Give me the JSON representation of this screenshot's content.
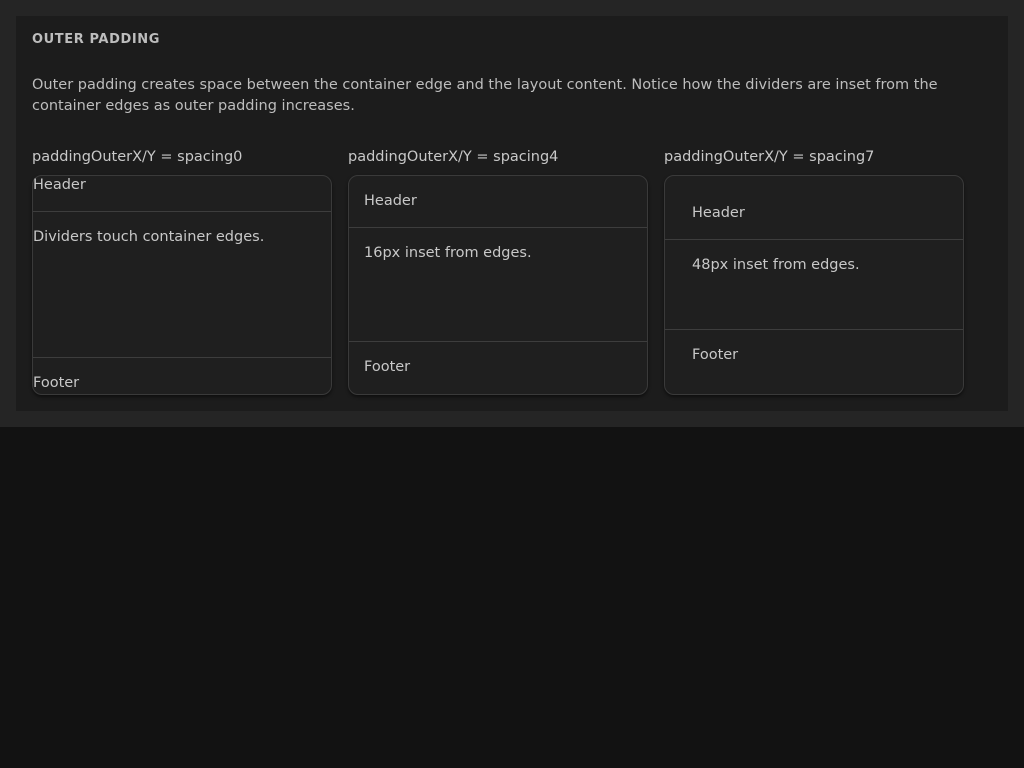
{
  "section": {
    "title": "OUTER PADDING",
    "description": "Outer padding creates space between the container edge and the layout content. Notice how the dividers are inset from the container edges as outer padding increases."
  },
  "examples": [
    {
      "label": "paddingOuterX/Y = spacing0",
      "header": "Header",
      "body": "Dividers touch container edges.",
      "footer": "Footer"
    },
    {
      "label": "paddingOuterX/Y = spacing4",
      "header": "Header",
      "body": "16px inset from edges.",
      "footer": "Footer"
    },
    {
      "label": "paddingOuterX/Y = spacing7",
      "header": "Header",
      "body": "48px inset from edges.",
      "footer": "Footer"
    }
  ]
}
